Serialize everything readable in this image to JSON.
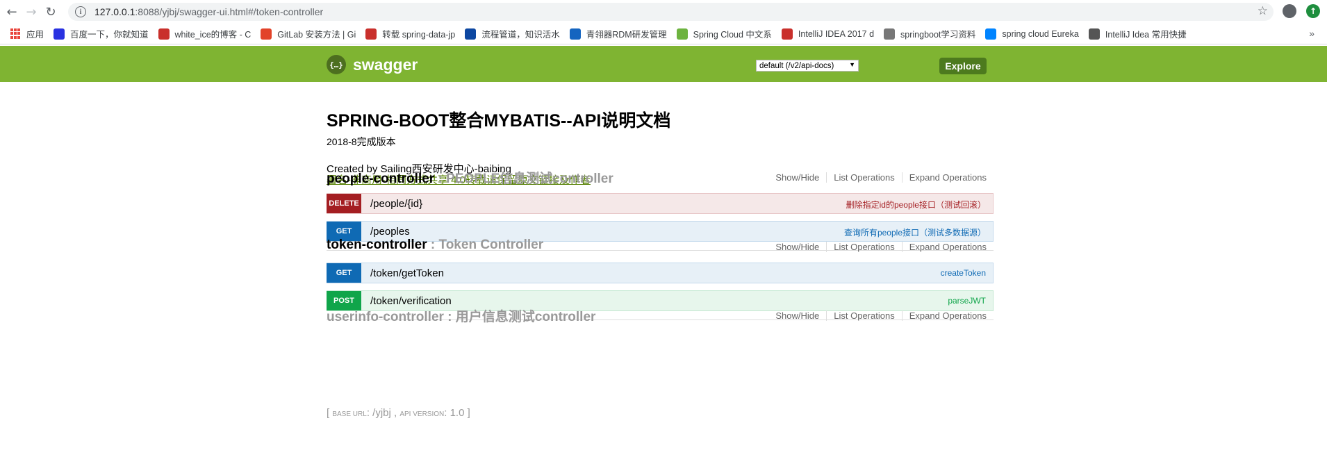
{
  "browser": {
    "url_host": "127.0.0.1",
    "url_rest": ":8088/yjbj/swagger-ui.html#/token-controller"
  },
  "bookmarks": [
    {
      "label": "应用",
      "color": "#e8453c"
    },
    {
      "label": "百度一下，你就知道",
      "color": "#2932e1"
    },
    {
      "label": "white_ice的博客 - C",
      "color": "#c9302c"
    },
    {
      "label": "GitLab 安装方法 | Gi",
      "color": "#e24329"
    },
    {
      "label": "转载 spring-data-jp",
      "color": "#c9302c"
    },
    {
      "label": "流程管道，知识活水",
      "color": "#0d47a1"
    },
    {
      "label": "青翎器RDM研发管理",
      "color": "#1565c0"
    },
    {
      "label": "Spring Cloud 中文系",
      "color": "#6db33f"
    },
    {
      "label": "IntelliJ IDEA 2017 d",
      "color": "#c9302c"
    },
    {
      "label": "springboot学习资料",
      "color": "#777777"
    },
    {
      "label": "spring cloud Eureka",
      "color": "#0084ff"
    },
    {
      "label": "IntelliJ Idea 常用快捷",
      "color": "#555555"
    }
  ],
  "header": {
    "logo_text": "swagger",
    "logo_glyph": "{…}",
    "spec_selected": "default (/v2/api-docs)",
    "explore_label": "Explore"
  },
  "info": {
    "title": "SPRING-BOOT整合MYBATIS--API说明文档",
    "version_desc": "2018-8完成版本",
    "created_by": "Created by Sailing西安研发中心-baibing",
    "license": "署名-非商用-相同方式共享 4.0转载请保留原文链接及作者"
  },
  "resource_links": {
    "show_hide": "Show/Hide",
    "list_ops": "List Operations",
    "expand_ops": "Expand Operations"
  },
  "resources": [
    {
      "name": "people-controller",
      "desc": " : PEOPLE信息测试controller",
      "operations": [
        {
          "method": "DELETE",
          "path": "/people/{id}",
          "summary": "删除指定id的people接口（测试回滚）"
        },
        {
          "method": "GET",
          "path": "/peoples",
          "summary": "查询所有people接口（测试多数据源）"
        }
      ]
    },
    {
      "name": "token-controller",
      "desc": " : Token Controller",
      "operations": [
        {
          "method": "GET",
          "path": "/token/getToken",
          "summary": "createToken"
        },
        {
          "method": "POST",
          "path": "/token/verification",
          "summary": "parseJWT"
        }
      ]
    },
    {
      "name": "userinfo-controller",
      "desc": " : 用户信息测试controller",
      "operations": []
    }
  ],
  "footer": {
    "open": "[ ",
    "base_url_label": "Base url",
    "base_url": ": /yjbj , ",
    "api_version_label": "api version",
    "api_version": ": 1.0 ]"
  }
}
